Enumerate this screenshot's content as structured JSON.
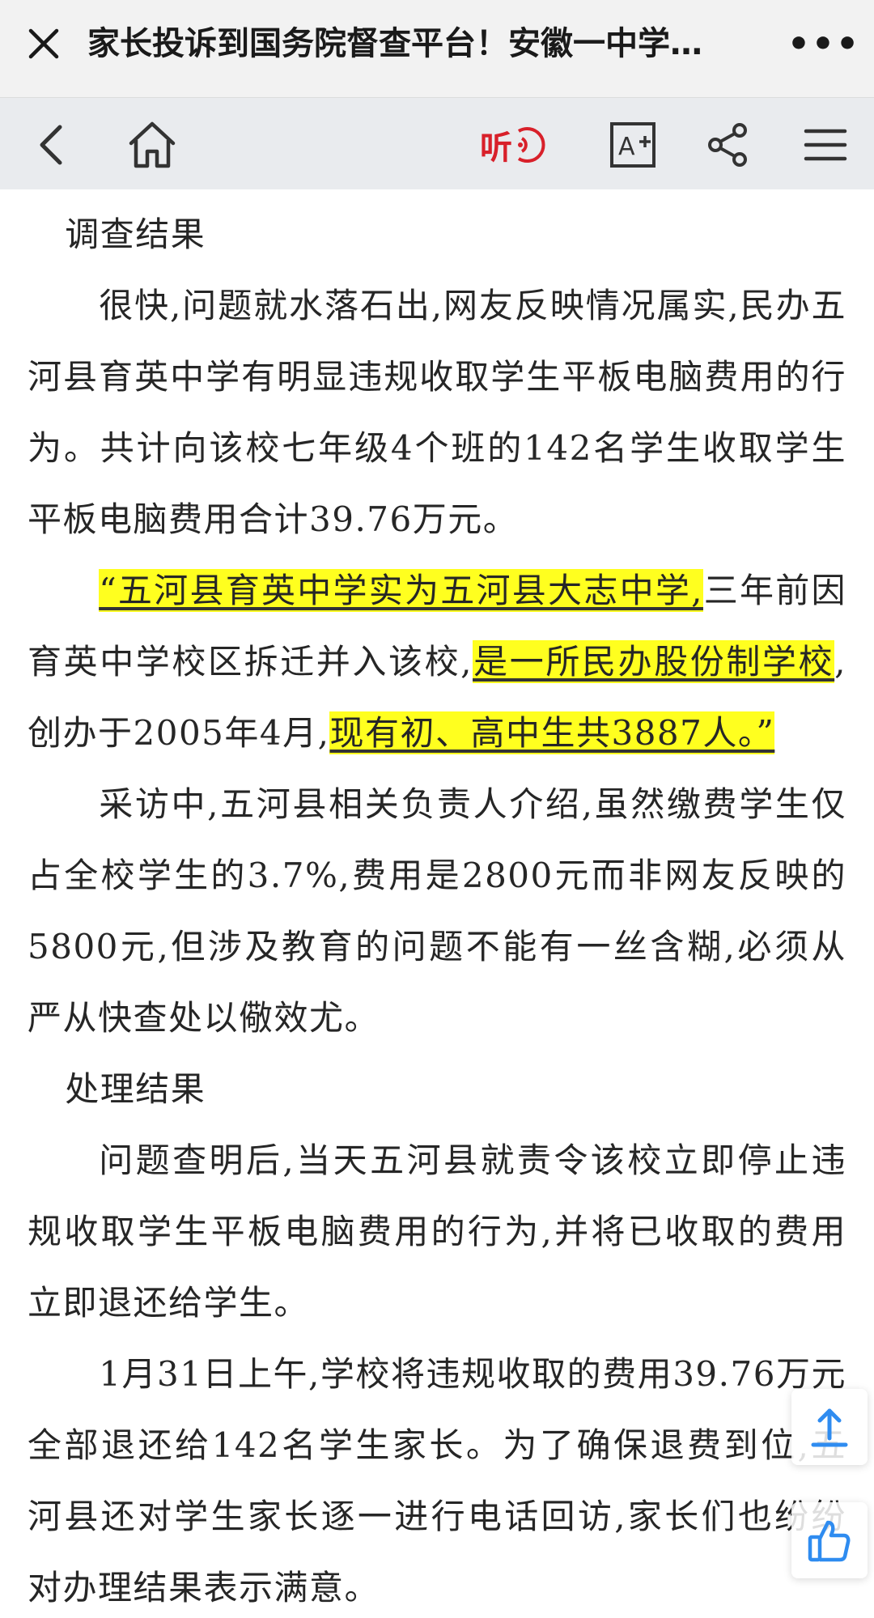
{
  "titlebar": {
    "title": "家长投诉到国务院督查平台！安徽一中学…",
    "more_label": "•••"
  },
  "toolbar": {
    "listen_label": "听"
  },
  "article": {
    "heading1": "调查结果",
    "p1": "很快,问题就水落石出,网友反映情况属实,民办五河县育英中学有明显违规收取学生平板电脑费用的行为。共计向该校七年级4个班的142名学生收取学生平板电脑费用合计39.76万元。",
    "p2": {
      "hl1": "“五河县育英中学实为五河县大志中学,",
      "t1": "三年前因育英中学校区拆迁并入该校,",
      "hl2": "是一所民办股份制学校",
      "t2": ",创办于2005年4月,",
      "hl3": "现有初、高中生共3887人。”"
    },
    "p3": "采访中,五河县相关负责人介绍,虽然缴费学生仅占全校学生的3.7%,费用是2800元而非网友反映的5800元,但涉及教育的问题不能有一丝含糊,必须从严从快查处以儆效尤。",
    "heading2": "处理结果",
    "p4": "问题查明后,当天五河县就责令该校立即停止违规收取学生平板电脑费用的行为,并将已收取的费用立即退还给学生。",
    "p5": "1月31日上午,学校将违规收取的费用39.76万元全部退还给142名学生家长。为了确保退费到位,五河县还对学生家长逐一进行电话回访,家长们也纷纷对办理结果表示满意。"
  },
  "icons": {
    "close": "close-icon",
    "back": "chevron-left-icon",
    "home": "home-icon",
    "listen": "listen-audio-icon",
    "font": "font-size-icon",
    "share": "share-icon",
    "menu": "menu-icon",
    "scroll_top": "scroll-top-icon",
    "like": "thumbs-up-icon"
  },
  "colors": {
    "highlight": "#ffff1f",
    "listen_red": "#d8202a",
    "icon_gray": "#333333",
    "float_blue": "#2f8cf0"
  }
}
